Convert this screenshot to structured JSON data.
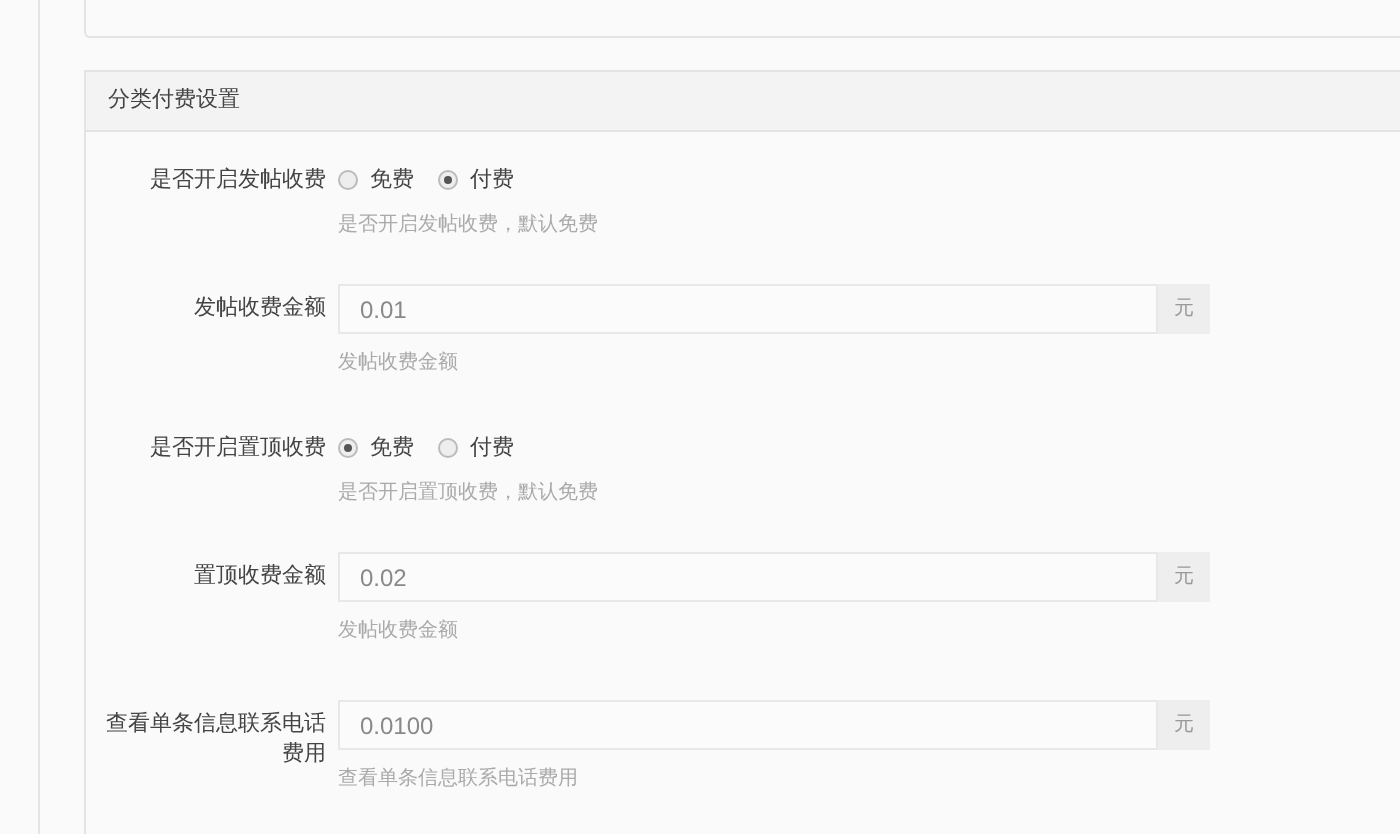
{
  "panel": {
    "title": "分类付费设置"
  },
  "rows": [
    {
      "kind": "radio",
      "label": "是否开启发帖收费",
      "options": [
        {
          "label": "免费",
          "selected": false
        },
        {
          "label": "付费",
          "selected": true
        }
      ],
      "help": "是否开启发帖收费，默认免费"
    },
    {
      "kind": "input",
      "label": "发帖收费金额",
      "value": "0.01",
      "addon": "元",
      "help": "发帖收费金额"
    },
    {
      "kind": "radio",
      "label": "是否开启置顶收费",
      "options": [
        {
          "label": "免费",
          "selected": true
        },
        {
          "label": "付费",
          "selected": false
        }
      ],
      "help": "是否开启置顶收费，默认免费"
    },
    {
      "kind": "input",
      "label": "置顶收费金额",
      "value": "0.02",
      "addon": "元",
      "help": "发帖收费金额"
    },
    {
      "kind": "input",
      "label": "查看单条信息联系电话费用",
      "value": "0.0100",
      "addon": "元",
      "help": "查看单条信息联系电话费用"
    }
  ]
}
